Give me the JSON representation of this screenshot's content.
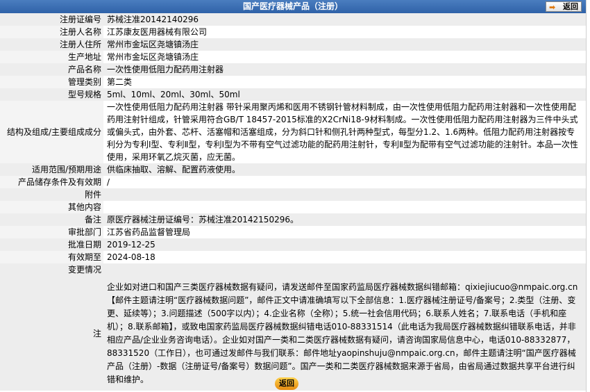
{
  "header": {
    "title": "国产医疗器械产品（注册）",
    "back_label": "返回"
  },
  "fields": [
    {
      "label": "注册证编号",
      "value": "苏械注准20142140296"
    },
    {
      "label": "注册人名称",
      "value": "江苏康友医用器械有限公司"
    },
    {
      "label": "注册人住所",
      "value": "常州市金坛区尧塘镇汤庄"
    },
    {
      "label": "生产地址",
      "value": "常州市金坛区尧塘镇汤庄"
    },
    {
      "label": "产品名称",
      "value": "一次性使用低阻力配药用注射器"
    },
    {
      "label": "管理类别",
      "value": "第二类"
    },
    {
      "label": "型号规格",
      "value": "5ml、10ml、20ml、30ml、50ml"
    },
    {
      "label": "结构及组成/主要组成成分",
      "value": "一次性使用低阻力配药用注射器 带针采用聚丙烯和医用不锈钢针管材料制成，由一次性使用低阻力配药用注射器和一次性使用配药用注射针组成，针管采用符合GB/T 18457-2015标准的X2CrNi18-9材料制成。一次性使用低阻力配药用注射器为三件中头式或偏头式，由外套、芯杆、活塞帽和活塞组成，分为斜口针和侧孔针两种型式，每型分1.2、1.6两种。低阻力配药用注射器按专利分为专利Ⅰ型、专利Ⅱ型，专利Ⅰ型为不带有空气过滤功能的配药用注射针，专利Ⅱ型为配带有空气过滤功能的注射针。本品一次性使用，采用环氧乙烷灭菌，应无菌。"
    },
    {
      "label": "适用范围/预期用途",
      "value": "供临床抽取、溶解、配置药液使用。"
    },
    {
      "label": "产品储存条件及有效期",
      "value": "/"
    },
    {
      "label": "附件",
      "value": ""
    },
    {
      "label": "其他内容",
      "value": ""
    },
    {
      "label": "备注",
      "value": "原医疗器械注册证编号：苏械注准20142150296。"
    },
    {
      "label": "审批部门",
      "value": "江苏省药品监督管理局"
    },
    {
      "label": "批准日期",
      "value": "2019-12-25"
    },
    {
      "label": "有效期至",
      "value": "2024-08-18"
    },
    {
      "label": "变更情况",
      "value": ""
    },
    {
      "label": "注",
      "value": "企业如对进口和国产三类医疗器械数据有疑问，请发送邮件至国家药监局医疗器械数据纠错邮箱：qixiejiucuo@nmpaic.org.cn【邮件主题请注明“医疗器械数据问题”，邮件正文中请准确填写以下全部信息：1.医疗器械注册证号/备案号；2.类型（注册、变更、延续等）；3.问题描述（500字以内）；4.企业名称（全称）；5.统一社会信用代码；6.联系人姓名；7.联系电话（手机和座机）；8.联系邮箱】，或致电国家药监局医疗器械数据纠错电话010-88331514（此电话为我局医疗器械数据纠错联系电话，并非相应产品/企业业务咨询电话）。企业如对国产一类和二类医疗器械数据有疑问，请咨询国家局信息中心，电话010-88332877，88331520（工作日），也可通过发邮件与我们联系：邮件地址yaopinshuju@nmpaic.org.cn，邮件主题请注明“国产医疗器械产品（注册）-数据（注册证号/备案号）数据问题”。国产一类和二类医疗器械数据来源于省局，由省局通过数据共享平台进行纠错和维护。"
    }
  ],
  "footer": {
    "back_label": "返回"
  },
  "colors": {
    "header_bg": "#2f62a8",
    "back_button": "#f0a020"
  }
}
